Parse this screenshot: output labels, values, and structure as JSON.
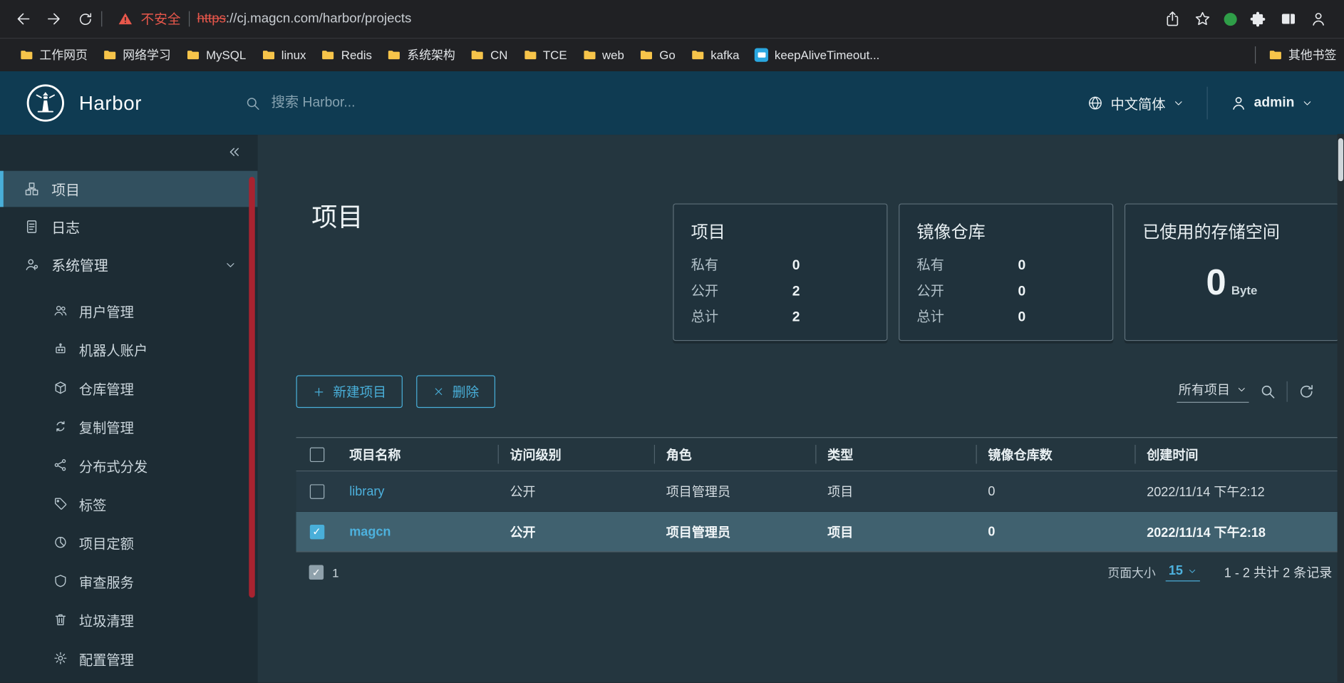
{
  "colors": {
    "accent_blue": "#49afd9",
    "header_bg": "#0f3b52",
    "danger_red": "#e8574b",
    "sidebar_scrollbar_red": "#a82330",
    "bookmark_folder_yellow": "#f6c44a",
    "link_blue": "#4db1dd"
  },
  "browser": {
    "security_label": "不安全",
    "url_protocol": "https",
    "url_rest": "://cj.magcn.com/harbor/projects"
  },
  "bookmarks": {
    "items": [
      "工作网页",
      "网络学习",
      "MySQL",
      "linux",
      "Redis",
      "系统架构",
      "CN",
      "TCE",
      "web",
      "Go",
      "kafka",
      "keepAliveTimeout..."
    ],
    "overflow": "其他书签"
  },
  "header": {
    "brand": "Harbor",
    "search_placeholder": "搜索 Harbor...",
    "language": "中文简体",
    "user": "admin"
  },
  "sidebar": {
    "items": [
      {
        "label": "项目"
      },
      {
        "label": "日志"
      },
      {
        "label": "系统管理"
      }
    ],
    "subitems": [
      {
        "label": "用户管理"
      },
      {
        "label": "机器人账户"
      },
      {
        "label": "仓库管理"
      },
      {
        "label": "复制管理"
      },
      {
        "label": "分布式分发"
      },
      {
        "label": "标签"
      },
      {
        "label": "项目定额"
      },
      {
        "label": "审查服务"
      },
      {
        "label": "垃圾清理"
      },
      {
        "label": "配置管理"
      }
    ]
  },
  "main": {
    "title": "项目"
  },
  "stats": {
    "projects": {
      "title": "项目",
      "rows": [
        {
          "label": "私有",
          "value": "0"
        },
        {
          "label": "公开",
          "value": "2"
        },
        {
          "label": "总计",
          "value": "2"
        }
      ]
    },
    "repositories": {
      "title": "镜像仓库",
      "rows": [
        {
          "label": "私有",
          "value": "0"
        },
        {
          "label": "公开",
          "value": "0"
        },
        {
          "label": "总计",
          "value": "0"
        }
      ]
    },
    "storage": {
      "title": "已使用的存储空间",
      "value": "0",
      "unit": "Byte"
    }
  },
  "toolbar": {
    "new_project": "新建项目",
    "delete": "删除",
    "filter": "所有项目"
  },
  "table": {
    "headers": [
      "项目名称",
      "访问级别",
      "角色",
      "类型",
      "镜像仓库数",
      "创建时间"
    ],
    "rows": [
      {
        "name": "library",
        "access": "公开",
        "role": "项目管理员",
        "type": "项目",
        "repo_count": "0",
        "created": "2022/11/14 下午2:12"
      },
      {
        "name": "magcn",
        "access": "公开",
        "role": "项目管理员",
        "type": "项目",
        "repo_count": "0",
        "created": "2022/11/14 下午2:18"
      }
    ],
    "footer": {
      "selected": "1",
      "page_size_label": "页面大小",
      "page_size": "15",
      "range": "1 - 2 共计 2 条记录"
    }
  }
}
